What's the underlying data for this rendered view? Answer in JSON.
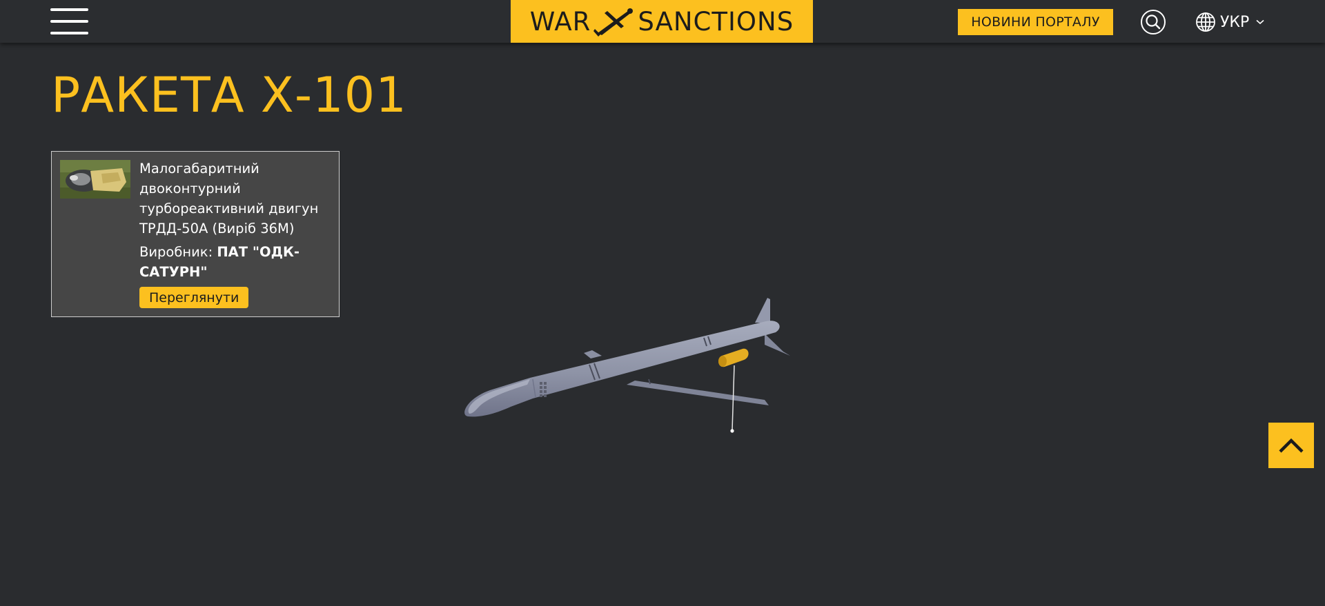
{
  "header": {
    "logo": {
      "left_word": "WAR",
      "right_word": "SANCTIONS"
    },
    "news_button": "НОВИНИ ПОРТАЛУ",
    "language": {
      "selected": "УКР"
    },
    "icons": {
      "menu": "hamburger-menu-icon",
      "search": "search-icon",
      "globe": "globe-icon",
      "chevron": "chevron-down-icon"
    }
  },
  "page": {
    "title": "РАКЕТА Х-101"
  },
  "component_card": {
    "description": "Малогабаритний двоконтурний турбореактивний двигун ТРДД-50А (Виріб 36М)",
    "manufacturer_label": "Виробник: ",
    "manufacturer_name": "ПАТ \"ОДК-САТУРН\"",
    "view_button": "Переглянути"
  },
  "colors": {
    "accent": "#fcc01f",
    "background": "#2a2c2f",
    "card_background": "#464646",
    "missile_body": "#8e93a6"
  }
}
